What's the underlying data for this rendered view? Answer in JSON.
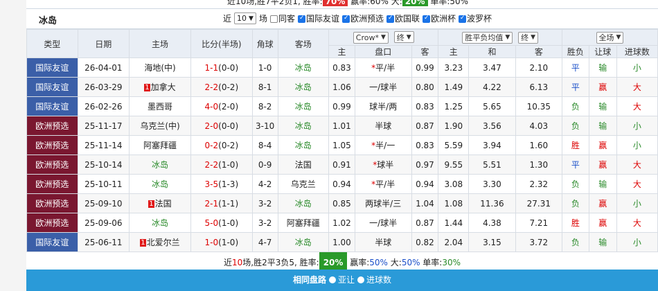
{
  "top_strip": {
    "prefix": "近10场,胜7平2负1, 胜率:",
    "win_rate": "70%",
    "mid": " 赢率:60% 大:",
    "big_rate": "20%",
    "tail": " 单率:50%"
  },
  "team_name": "冰岛",
  "filters": {
    "recent_label": "近",
    "count_value": "10",
    "count_unit": "场",
    "options": [
      {
        "label": "同客",
        "checked": false
      },
      {
        "label": "国际友谊",
        "checked": true
      },
      {
        "label": "欧洲预选",
        "checked": true
      },
      {
        "label": "欧国联",
        "checked": true
      },
      {
        "label": "欧洲杯",
        "checked": true
      },
      {
        "label": "波罗杯",
        "checked": true
      }
    ]
  },
  "headers": {
    "type": "类型",
    "date": "日期",
    "home": "主场",
    "score": "比分(半场)",
    "corner": "角球",
    "away": "客场",
    "company_select": "Crow*",
    "ah_select": "终",
    "odds_select": "胜平负均值",
    "odds_final_select": "终",
    "range_select": "全场",
    "sub": {
      "h_home": "主",
      "h_line": "盘口",
      "h_away": "客",
      "o_home": "主",
      "o_draw": "和",
      "o_away": "客",
      "result": "胜负",
      "handicap_res": "让球",
      "goals_res": "进球数"
    }
  },
  "rows": [
    {
      "league": "国际友谊",
      "league_color": "blue",
      "date": "26-04-01",
      "home": "海地(中)",
      "home_rank": "",
      "home_green": false,
      "score": "1-1",
      "half": "(0-0)",
      "corner": "1-0",
      "away": "冰岛",
      "away_rank": "",
      "away_green": true,
      "ah_home": "0.83",
      "ah_star": "*",
      "ah_line": "平/半",
      "ah_away": "0.99",
      "o_home": "3.23",
      "o_draw": "3.47",
      "o_away": "2.10",
      "result": "平",
      "result_cls": "res-draw",
      "hres": "输",
      "hres_cls": "res-lose",
      "goals": "小",
      "goals_cls": "res-lose"
    },
    {
      "league": "国际友谊",
      "league_color": "blue",
      "date": "26-03-29",
      "home": "加拿大",
      "home_rank": "1",
      "home_green": false,
      "score": "2-2",
      "half": "(0-2)",
      "corner": "8-1",
      "away": "冰岛",
      "away_rank": "",
      "away_green": true,
      "ah_home": "1.06",
      "ah_star": "",
      "ah_line": "一/球半",
      "ah_away": "0.80",
      "o_home": "1.49",
      "o_draw": "4.22",
      "o_away": "6.13",
      "result": "平",
      "result_cls": "res-draw",
      "hres": "赢",
      "hres_cls": "res-win",
      "goals": "大",
      "goals_cls": "res-win"
    },
    {
      "league": "国际友谊",
      "league_color": "blue",
      "date": "26-02-26",
      "home": "墨西哥",
      "home_rank": "",
      "home_green": false,
      "score": "4-0",
      "half": "(2-0)",
      "corner": "8-2",
      "away": "冰岛",
      "away_rank": "",
      "away_green": true,
      "ah_home": "0.99",
      "ah_star": "",
      "ah_line": "球半/两",
      "ah_away": "0.83",
      "o_home": "1.25",
      "o_draw": "5.65",
      "o_away": "10.35",
      "result": "负",
      "result_cls": "res-lose",
      "hres": "输",
      "hres_cls": "res-lose",
      "goals": "大",
      "goals_cls": "res-win"
    },
    {
      "league": "欧洲预选",
      "league_color": "maroon",
      "date": "25-11-17",
      "home": "乌克兰(中)",
      "home_rank": "",
      "home_green": false,
      "score": "2-0",
      "half": "(0-0)",
      "corner": "3-10",
      "away": "冰岛",
      "away_rank": "",
      "away_green": true,
      "ah_home": "1.01",
      "ah_star": "",
      "ah_line": "半球",
      "ah_away": "0.87",
      "o_home": "1.90",
      "o_draw": "3.56",
      "o_away": "4.03",
      "result": "负",
      "result_cls": "res-lose",
      "hres": "输",
      "hres_cls": "res-lose",
      "goals": "小",
      "goals_cls": "res-lose"
    },
    {
      "league": "欧洲预选",
      "league_color": "maroon",
      "date": "25-11-14",
      "home": "阿塞拜疆",
      "home_rank": "",
      "home_green": false,
      "score": "0-2",
      "half": "(0-2)",
      "corner": "8-4",
      "away": "冰岛",
      "away_rank": "",
      "away_green": true,
      "ah_home": "1.05",
      "ah_star": "*",
      "ah_line": "半/一",
      "ah_away": "0.83",
      "o_home": "5.59",
      "o_draw": "3.94",
      "o_away": "1.60",
      "result": "胜",
      "result_cls": "res-win",
      "hres": "赢",
      "hres_cls": "res-win",
      "goals": "小",
      "goals_cls": "res-lose"
    },
    {
      "league": "欧洲预选",
      "league_color": "maroon",
      "date": "25-10-14",
      "home": "冰岛",
      "home_rank": "",
      "home_green": true,
      "score": "2-2",
      "half": "(1-0)",
      "corner": "0-9",
      "away": "法国",
      "away_rank": "",
      "away_green": false,
      "ah_home": "0.91",
      "ah_star": "*",
      "ah_line": "球半",
      "ah_away": "0.97",
      "o_home": "9.55",
      "o_draw": "5.51",
      "o_away": "1.30",
      "result": "平",
      "result_cls": "res-draw",
      "hres": "赢",
      "hres_cls": "res-win",
      "goals": "大",
      "goals_cls": "res-win"
    },
    {
      "league": "欧洲预选",
      "league_color": "maroon",
      "date": "25-10-11",
      "home": "冰岛",
      "home_rank": "",
      "home_green": true,
      "score": "3-5",
      "half": "(1-3)",
      "corner": "4-2",
      "away": "乌克兰",
      "away_rank": "",
      "away_green": false,
      "ah_home": "0.94",
      "ah_star": "*",
      "ah_line": "平/半",
      "ah_away": "0.94",
      "o_home": "3.08",
      "o_draw": "3.30",
      "o_away": "2.32",
      "result": "负",
      "result_cls": "res-lose",
      "hres": "输",
      "hres_cls": "res-lose",
      "goals": "大",
      "goals_cls": "res-win"
    },
    {
      "league": "欧洲预选",
      "league_color": "maroon",
      "date": "25-09-10",
      "home": "法国",
      "home_rank": "1",
      "home_green": false,
      "score": "2-1",
      "half": "(1-1)",
      "corner": "3-2",
      "away": "冰岛",
      "away_rank": "",
      "away_green": true,
      "ah_home": "0.85",
      "ah_star": "",
      "ah_line": "两球半/三",
      "ah_away": "1.04",
      "o_home": "1.08",
      "o_draw": "11.36",
      "o_away": "27.31",
      "result": "负",
      "result_cls": "res-lose",
      "hres": "赢",
      "hres_cls": "res-win",
      "goals": "小",
      "goals_cls": "res-lose"
    },
    {
      "league": "欧洲预选",
      "league_color": "maroon",
      "date": "25-09-06",
      "home": "冰岛",
      "home_rank": "",
      "home_green": true,
      "score": "5-0",
      "half": "(1-0)",
      "corner": "3-2",
      "away": "阿塞拜疆",
      "away_rank": "",
      "away_green": false,
      "ah_home": "1.02",
      "ah_star": "",
      "ah_line": "一/球半",
      "ah_away": "0.87",
      "o_home": "1.44",
      "o_draw": "4.38",
      "o_away": "7.21",
      "result": "胜",
      "result_cls": "res-win",
      "hres": "赢",
      "hres_cls": "res-win",
      "goals": "大",
      "goals_cls": "res-win"
    },
    {
      "league": "国际友谊",
      "league_color": "blue",
      "date": "25-06-11",
      "home": "北爱尔兰",
      "home_rank": "1",
      "home_green": false,
      "score": "1-0",
      "half": "(1-0)",
      "corner": "4-7",
      "away": "冰岛",
      "away_rank": "",
      "away_green": true,
      "ah_home": "1.00",
      "ah_star": "",
      "ah_line": "半球",
      "ah_away": "0.82",
      "o_home": "2.04",
      "o_draw": "3.15",
      "o_away": "3.72",
      "result": "负",
      "result_cls": "res-lose",
      "hres": "输",
      "hres_cls": "res-lose",
      "goals": "小",
      "goals_cls": "res-lose"
    }
  ],
  "summary": {
    "prefix": "近",
    "count": "10",
    "mid": "场,胜2平3负5, 胜率:",
    "win_rate": "20%",
    "win_label": " 赢率:",
    "win_pct": "50%",
    "big_label": " 大:",
    "big_pct": "50%",
    "single_label": " 单率:",
    "single_pct": "30%"
  },
  "section": {
    "title": "相同盘路",
    "radio1": "亚让",
    "radio2": "进球数"
  }
}
